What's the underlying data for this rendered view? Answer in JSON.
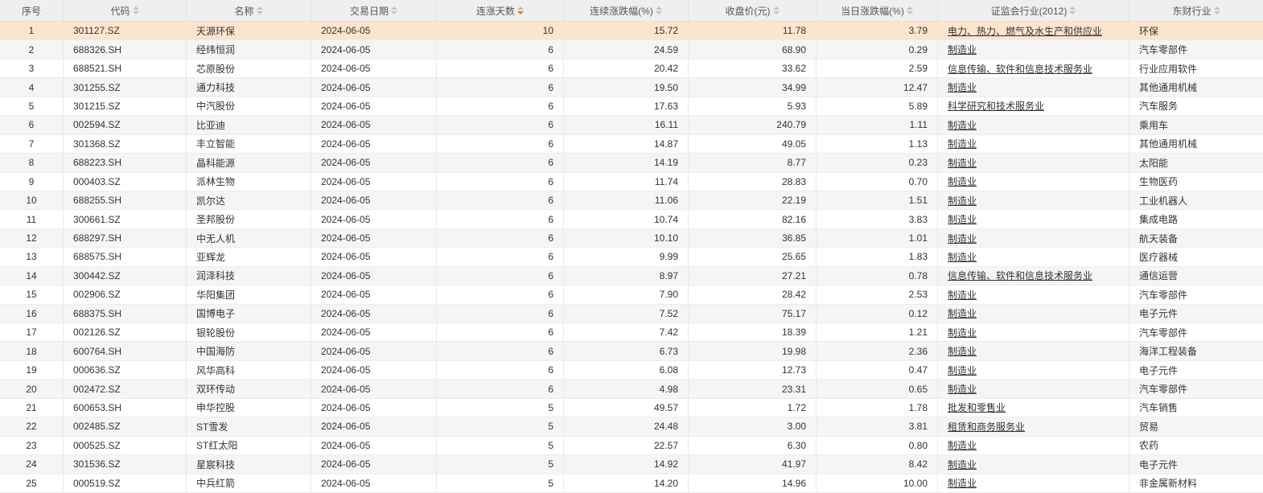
{
  "table": {
    "columns": [
      {
        "key": "seq",
        "label": "序号",
        "align": "center",
        "sortable": false
      },
      {
        "key": "code",
        "label": "代码",
        "align": "left",
        "sortable": true
      },
      {
        "key": "name",
        "label": "名称",
        "align": "left",
        "sortable": true
      },
      {
        "key": "date",
        "label": "交易日期",
        "align": "left",
        "sortable": true
      },
      {
        "key": "streak_days",
        "label": "连涨天数",
        "align": "right",
        "sortable": true,
        "sort": "desc"
      },
      {
        "key": "cum_change_pct",
        "label": "连续涨跌幅(%)",
        "align": "right",
        "sortable": true
      },
      {
        "key": "close_price",
        "label": "收盘价(元)",
        "align": "right",
        "sortable": true
      },
      {
        "key": "day_change_pct",
        "label": "当日涨跌幅(%)",
        "align": "right",
        "sortable": true
      },
      {
        "key": "csrc_industry",
        "label": "证监会行业(2012)",
        "align": "left",
        "sortable": true,
        "link": true
      },
      {
        "key": "em_industry",
        "label": "东财行业",
        "align": "left",
        "sortable": true
      }
    ],
    "sort": {
      "column": "连涨天数",
      "direction": "desc"
    },
    "highlighted_row_seq": "1",
    "rows": [
      [
        "1",
        "301127.SZ",
        "天源环保",
        "2024-06-05",
        "10",
        "15.72",
        "11.78",
        "3.79",
        "电力、热力、燃气及水生产和供应业",
        "环保"
      ],
      [
        "2",
        "688326.SH",
        "经纬恒润",
        "2024-06-05",
        "6",
        "24.59",
        "68.90",
        "0.29",
        "制造业",
        "汽车零部件"
      ],
      [
        "3",
        "688521.SH",
        "芯原股份",
        "2024-06-05",
        "6",
        "20.42",
        "33.62",
        "2.59",
        "信息传输、软件和信息技术服务业",
        "行业应用软件"
      ],
      [
        "4",
        "301255.SZ",
        "通力科技",
        "2024-06-05",
        "6",
        "19.50",
        "34.99",
        "12.47",
        "制造业",
        "其他通用机械"
      ],
      [
        "5",
        "301215.SZ",
        "中汽股份",
        "2024-06-05",
        "6",
        "17.63",
        "5.93",
        "5.89",
        "科学研究和技术服务业",
        "汽车服务"
      ],
      [
        "6",
        "002594.SZ",
        "比亚迪",
        "2024-06-05",
        "6",
        "16.11",
        "240.79",
        "1.11",
        "制造业",
        "乘用车"
      ],
      [
        "7",
        "301368.SZ",
        "丰立智能",
        "2024-06-05",
        "6",
        "14.87",
        "49.05",
        "1.13",
        "制造业",
        "其他通用机械"
      ],
      [
        "8",
        "688223.SH",
        "晶科能源",
        "2024-06-05",
        "6",
        "14.19",
        "8.77",
        "0.23",
        "制造业",
        "太阳能"
      ],
      [
        "9",
        "000403.SZ",
        "派林生物",
        "2024-06-05",
        "6",
        "11.74",
        "28.83",
        "0.70",
        "制造业",
        "生物医药"
      ],
      [
        "10",
        "688255.SH",
        "凯尔达",
        "2024-06-05",
        "6",
        "11.06",
        "22.19",
        "1.51",
        "制造业",
        "工业机器人"
      ],
      [
        "11",
        "300661.SZ",
        "圣邦股份",
        "2024-06-05",
        "6",
        "10.74",
        "82.16",
        "3.83",
        "制造业",
        "集成电路"
      ],
      [
        "12",
        "688297.SH",
        "中无人机",
        "2024-06-05",
        "6",
        "10.10",
        "36.85",
        "1.01",
        "制造业",
        "航天装备"
      ],
      [
        "13",
        "688575.SH",
        "亚辉龙",
        "2024-06-05",
        "6",
        "9.99",
        "25.65",
        "1.83",
        "制造业",
        "医疗器械"
      ],
      [
        "14",
        "300442.SZ",
        "润泽科技",
        "2024-06-05",
        "6",
        "8.97",
        "27.21",
        "0.78",
        "信息传输、软件和信息技术服务业",
        "通信运营"
      ],
      [
        "15",
        "002906.SZ",
        "华阳集团",
        "2024-06-05",
        "6",
        "7.90",
        "28.42",
        "2.53",
        "制造业",
        "汽车零部件"
      ],
      [
        "16",
        "688375.SH",
        "国博电子",
        "2024-06-05",
        "6",
        "7.52",
        "75.17",
        "0.12",
        "制造业",
        "电子元件"
      ],
      [
        "17",
        "002126.SZ",
        "银轮股份",
        "2024-06-05",
        "6",
        "7.42",
        "18.39",
        "1.21",
        "制造业",
        "汽车零部件"
      ],
      [
        "18",
        "600764.SH",
        "中国海防",
        "2024-06-05",
        "6",
        "6.73",
        "19.98",
        "2.36",
        "制造业",
        "海洋工程装备"
      ],
      [
        "19",
        "000636.SZ",
        "风华高科",
        "2024-06-05",
        "6",
        "6.08",
        "12.73",
        "0.47",
        "制造业",
        "电子元件"
      ],
      [
        "20",
        "002472.SZ",
        "双环传动",
        "2024-06-05",
        "6",
        "4.98",
        "23.31",
        "0.65",
        "制造业",
        "汽车零部件"
      ],
      [
        "21",
        "600653.SH",
        "申华控股",
        "2024-06-05",
        "5",
        "49.57",
        "1.72",
        "1.78",
        "批发和零售业",
        "汽车销售"
      ],
      [
        "22",
        "002485.SZ",
        "ST雪发",
        "2024-06-05",
        "5",
        "24.48",
        "3.00",
        "3.81",
        "租赁和商务服务业",
        "贸易"
      ],
      [
        "23",
        "000525.SZ",
        "ST红太阳",
        "2024-06-05",
        "5",
        "22.57",
        "6.30",
        "0.80",
        "制造业",
        "农药"
      ],
      [
        "24",
        "301536.SZ",
        "星宸科技",
        "2024-06-05",
        "5",
        "14.92",
        "41.97",
        "8.42",
        "制造业",
        "电子元件"
      ],
      [
        "25",
        "000519.SZ",
        "中兵红箭",
        "2024-06-05",
        "5",
        "14.20",
        "14.96",
        "10.00",
        "制造业",
        "非金属新材料"
      ]
    ]
  },
  "colors": {
    "row_highlight": "#fce4cd",
    "row_alt": "#f5f5f5",
    "header_bg": "#efefef",
    "border": "#e9e9e9",
    "text": "#333333",
    "sort_active": "#f86e06",
    "sort_inactive": "#c3c3c3"
  }
}
